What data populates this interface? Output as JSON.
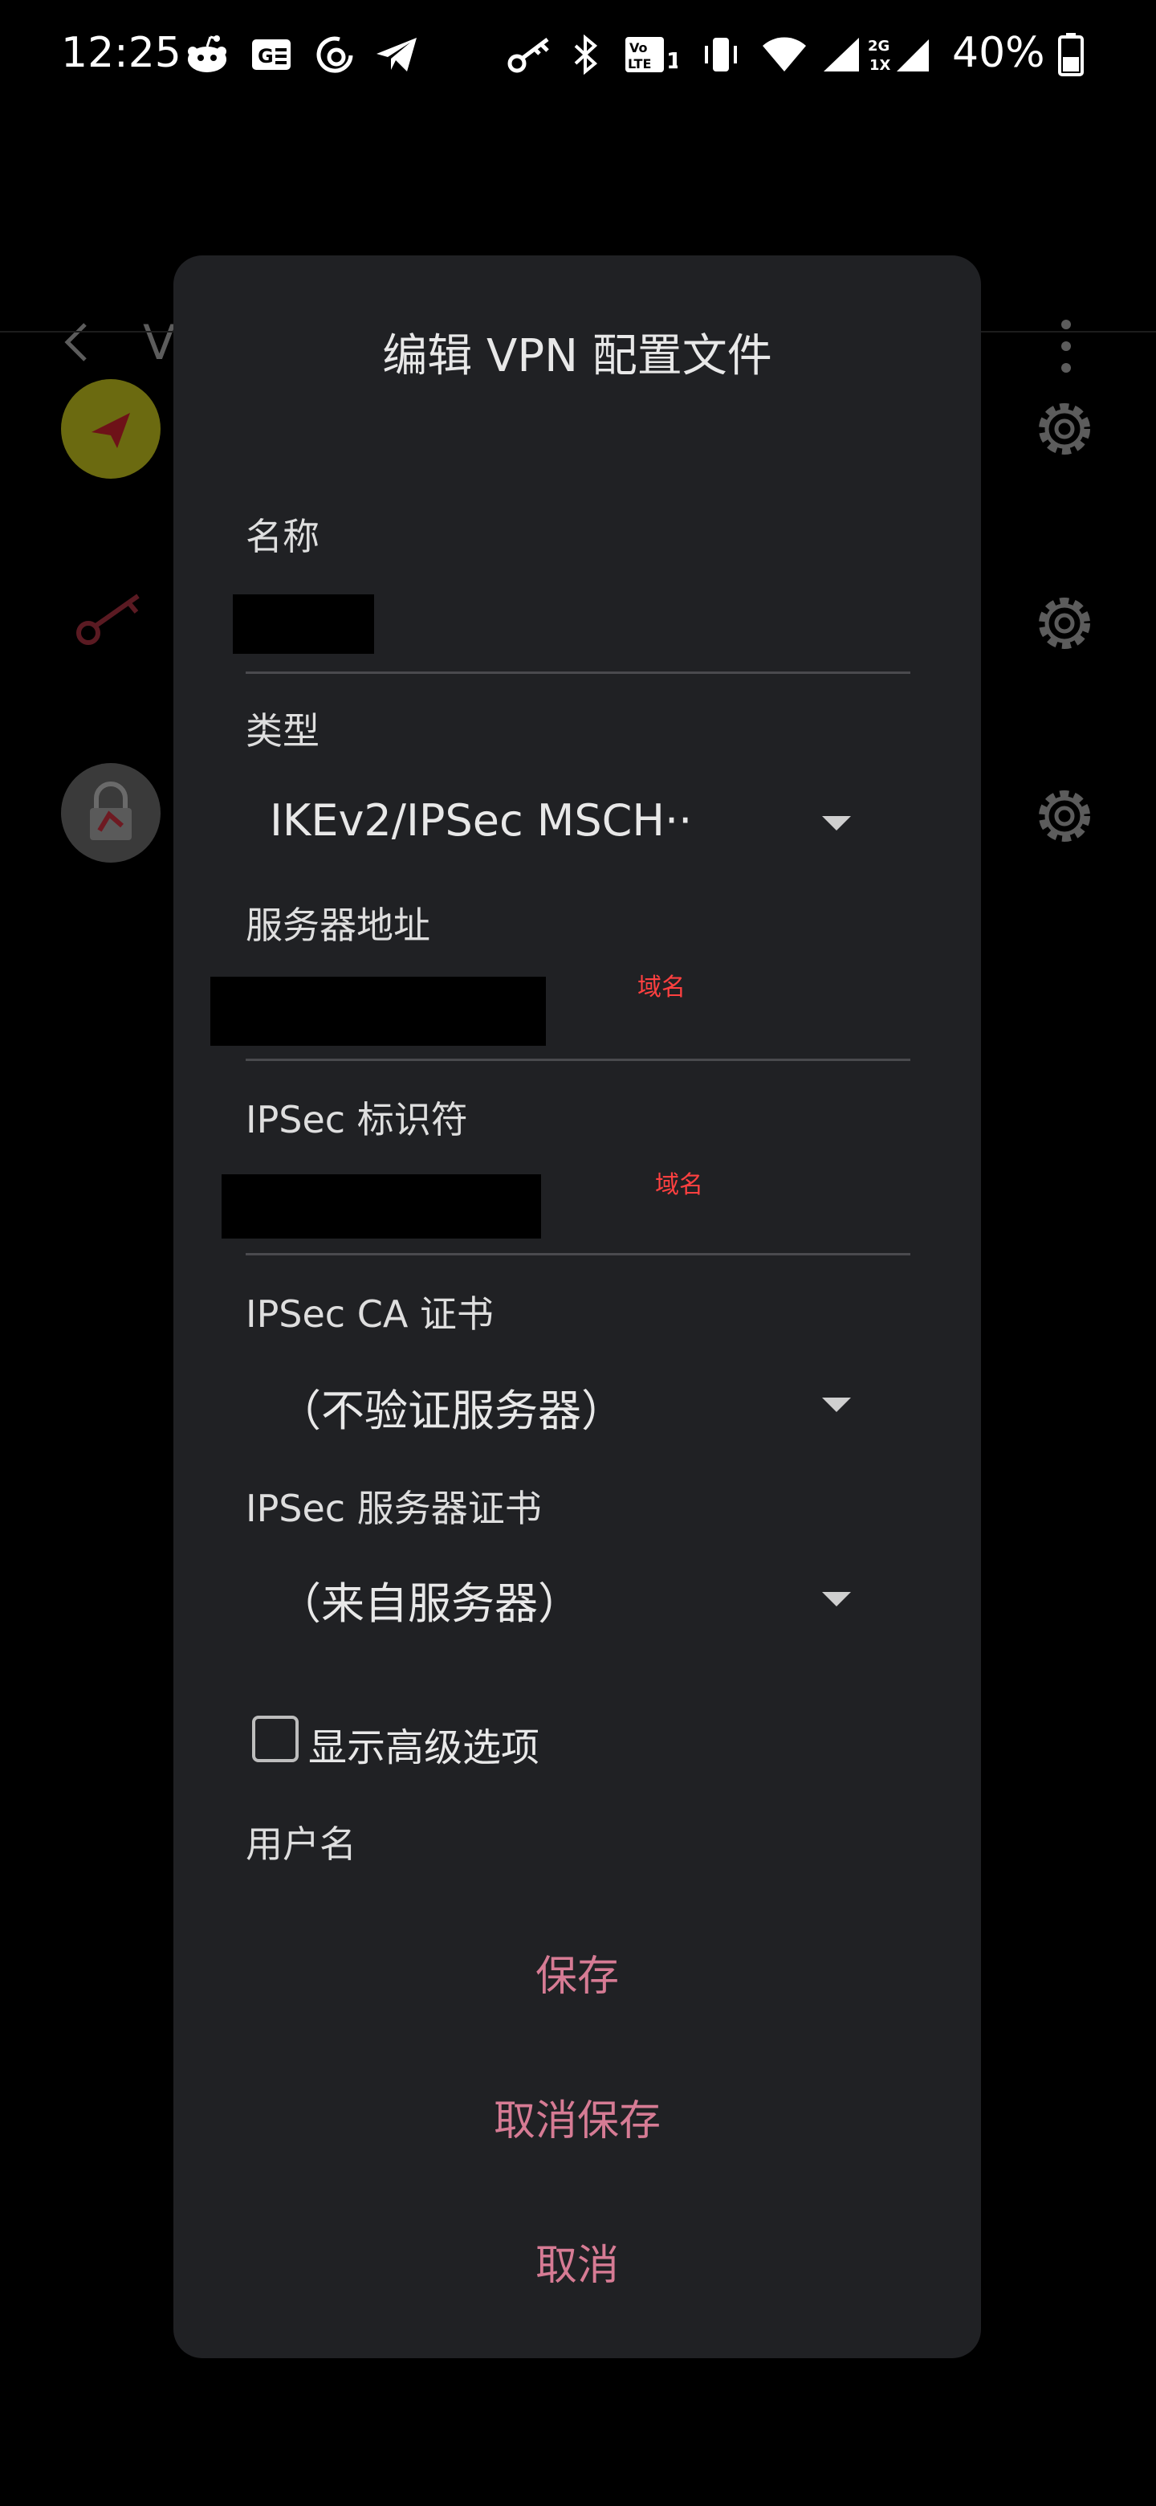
{
  "status_bar": {
    "time": "12:25",
    "battery_percent": "40%",
    "icons_left": [
      "reddit-icon",
      "news-icon",
      "netease-music-icon",
      "telegram-icon"
    ],
    "icons_right": [
      "vpn-key-icon",
      "bluetooth-icon",
      "volte-icon",
      "vibrate-icon",
      "wifi-icon",
      "signal-icon",
      "signal-2g-icon",
      "battery-icon"
    ],
    "volte_label": "Vo LTE 1",
    "network_labels": [
      "2G",
      "1X"
    ]
  },
  "app_bar": {
    "title": "VPN"
  },
  "background_list": {
    "items": [
      "paper-plane-app-icon",
      "key-app-icon",
      "lock-app-icon"
    ]
  },
  "dialog": {
    "title": "编辑 VPN 配置文件",
    "fields": {
      "name_label": "名称",
      "type_label": "类型",
      "type_value": "IKEv2/IPSec MSCH··",
      "server_label": "服务器地址",
      "server_note": "域名",
      "ipsec_id_label": "IPSec 标识符",
      "ipsec_id_note": "域名",
      "ca_cert_label": "IPSec CA 证书",
      "ca_cert_value": "（不验证服务器）",
      "server_cert_label": "IPSec 服务器证书",
      "server_cert_value": "（来自服务器）",
      "advanced_label": "显示高级选项",
      "username_label": "用户名"
    },
    "advanced_checked": false,
    "buttons": {
      "save": "保存",
      "delete": "取消保存",
      "cancel": "取消"
    }
  },
  "colors": {
    "accent": "#d67b94",
    "dialog_bg": "#202124",
    "note_red": "#ff4040"
  }
}
